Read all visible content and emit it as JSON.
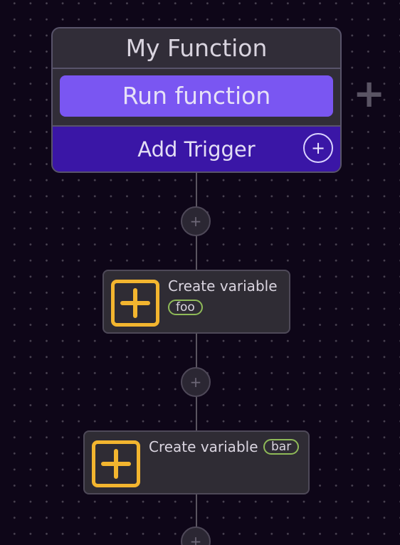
{
  "trigger": {
    "title": "My Function",
    "run_label": "Run function",
    "add_trigger_label": "Add Trigger",
    "add_trigger_icon": "plus-circle-icon"
  },
  "canvas": {
    "add_branch_icon": "plus-icon",
    "add_step_icon": "plus-icon"
  },
  "steps": [
    {
      "label": "Create variable",
      "variable": "foo",
      "icon": "create-variable-icon"
    },
    {
      "label": "Create variable",
      "variable": "bar",
      "icon": "create-variable-icon"
    }
  ],
  "colors": {
    "background": "#0e0618",
    "run_button": "#7a56f2",
    "add_trigger": "#3a16a6",
    "step_icon": "#f3b52f",
    "variable_pill": "#8fba58"
  }
}
